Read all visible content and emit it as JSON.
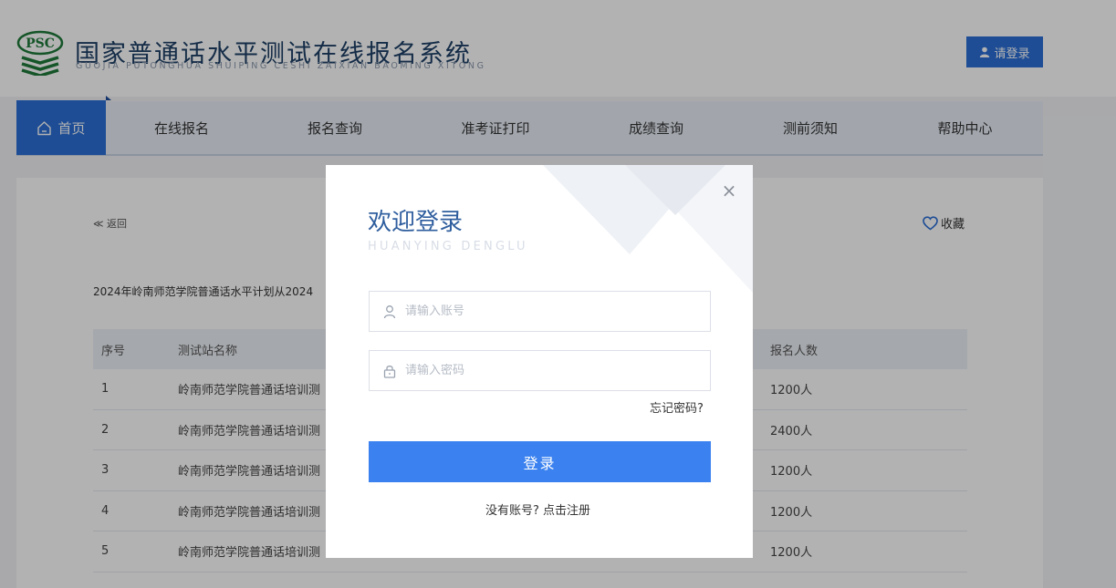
{
  "header": {
    "title": "国家普通话水平测试在线报名系统",
    "pinyin": "GUOJIA PUTONGHUA SHUIPING CESHI ZAIXIAN BAOMING XITONG",
    "logo_text": "PSC",
    "login_label": "请登录"
  },
  "nav": {
    "items": [
      "首页",
      "在线报名",
      "报名查询",
      "准考证打印",
      "成绩查询",
      "测前须知",
      "帮助中心"
    ]
  },
  "content": {
    "back_label": "≪ 返回",
    "favorite_label": "收藏",
    "notice": "2024年岭南师范学院普通话水平计划从2024",
    "table": {
      "headers": [
        "序号",
        "测试站名称",
        "报名人数"
      ],
      "rows": [
        {
          "idx": "1",
          "name": "岭南师范学院普通话培训测",
          "count": "1200人"
        },
        {
          "idx": "2",
          "name": "岭南师范学院普通话培训测",
          "count": "2400人"
        },
        {
          "idx": "3",
          "name": "岭南师范学院普通话培训测",
          "count": "1200人"
        },
        {
          "idx": "4",
          "name": "岭南师范学院普通话培训测",
          "count": "1200人"
        },
        {
          "idx": "5",
          "name": "岭南师范学院普通话培训测",
          "count": "1200人"
        }
      ]
    }
  },
  "modal": {
    "title": "欢迎登录",
    "subtitle": "HUANYING DENGLU",
    "close_label": "×",
    "username_placeholder": "请输入账号",
    "password_placeholder": "请输入密码",
    "forgot_label": "忘记密码?",
    "submit_label": "登录",
    "register_label": "没有账号? 点击注册"
  },
  "colors": {
    "brand_blue": "#2b6fd6",
    "button_blue": "#3b82f0",
    "title_blue": "#2f5e9e",
    "logo_green": "#1f7a3a"
  }
}
